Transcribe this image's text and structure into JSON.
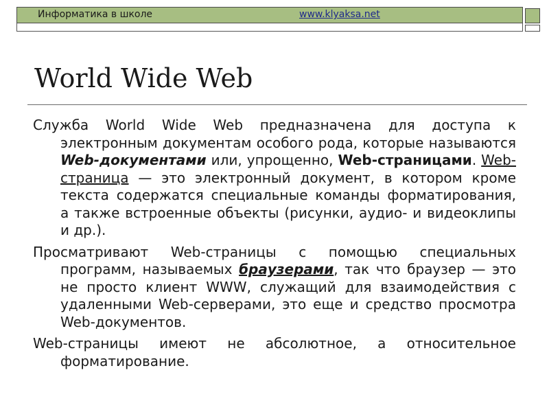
{
  "header": {
    "site_name": "Информатика в школе",
    "site_url": "www.klyaksa.net"
  },
  "slide": {
    "title": "World Wide Web"
  },
  "paragraphs": {
    "p1": {
      "t1": "Служба World Wide Web предназначена для доступа к электронным документам особого рода, которые называются ",
      "t2": "Web-документами",
      "t3": " или, упрощенно, ",
      "t4": "Web-страницами",
      "t5": ". ",
      "t6": "Web-страница",
      "t7": " — это электронный документ, в котором кроме текста содержатся специальные команды форматирования, а также встроенные объекты (рисунки, аудио- и видеоклипы и др.)."
    },
    "p2": {
      "t1": "Просматривают Web-страницы с помощью специальных программ, называемых ",
      "t2": "браузерами",
      "t3": ", так что браузер — это не просто клиент WWW, служащий для взаимодействия с удаленными Web-серверами, это еще и средство просмотра Web-документов."
    },
    "p3": {
      "t1": "Web-страницы имеют не абсолютное, а относительное форматирование."
    }
  },
  "colors": {
    "header_bar": "#a7be82",
    "link": "#1f2a8a",
    "text": "#1a1a1a"
  }
}
